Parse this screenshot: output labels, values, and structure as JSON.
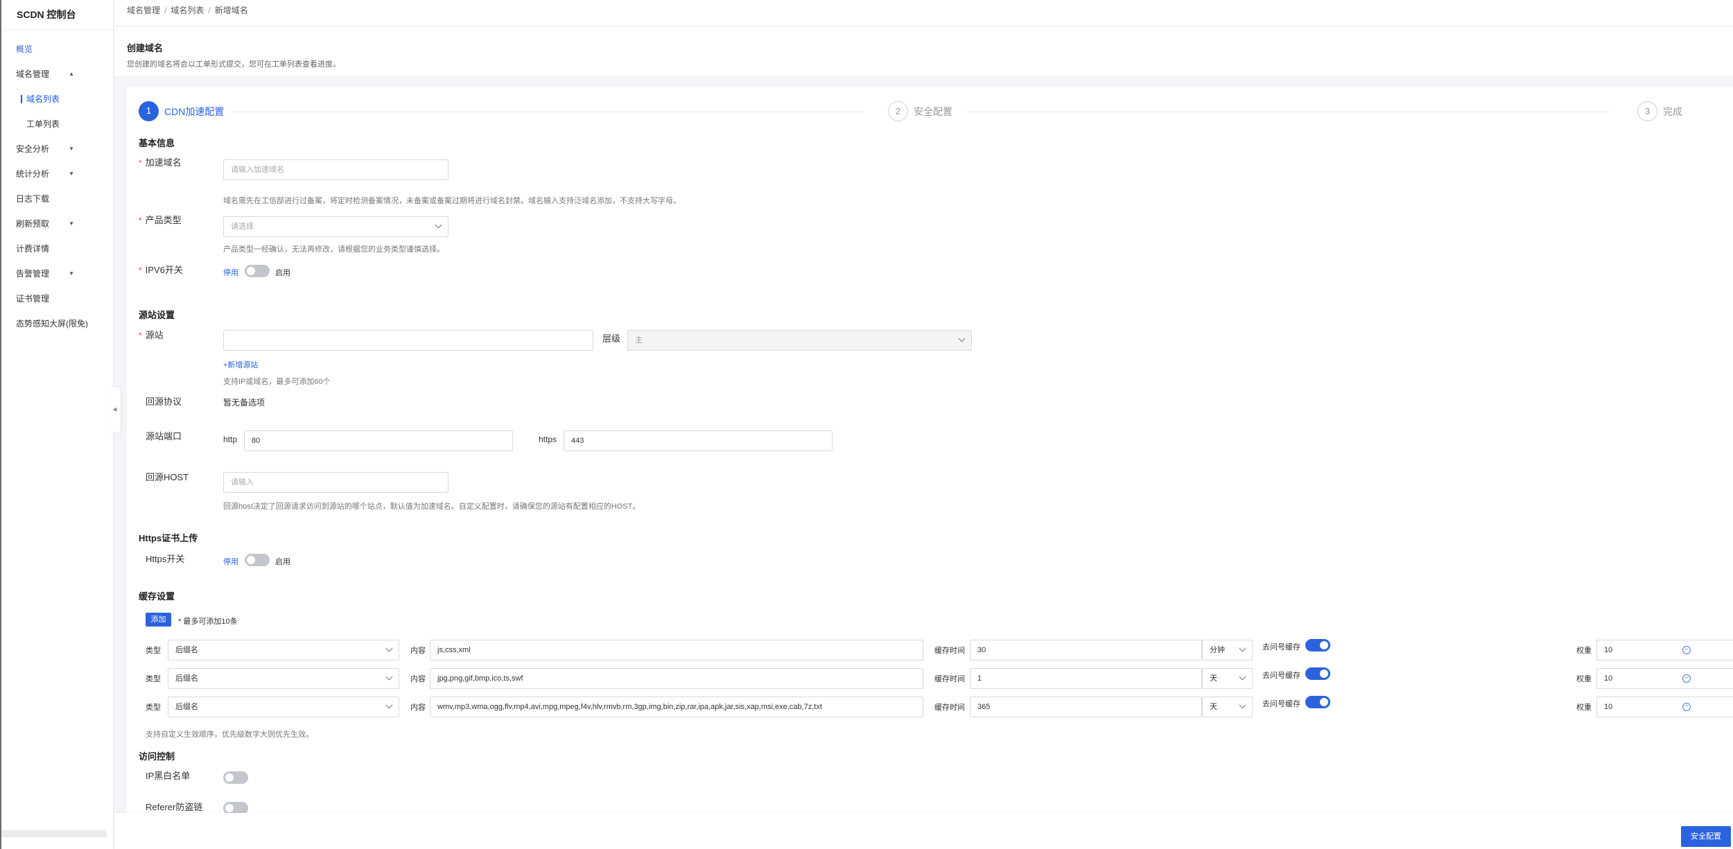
{
  "app": {
    "title": "SCDN 控制台"
  },
  "sidebar": {
    "items": [
      {
        "label": "概览"
      },
      {
        "label": "域名管理",
        "arrow": "▲"
      },
      {
        "label": "域名列表"
      },
      {
        "label": "工单列表"
      },
      {
        "label": "安全分析",
        "arrow": "▼"
      },
      {
        "label": "统计分析",
        "arrow": "▼"
      },
      {
        "label": "日志下载"
      },
      {
        "label": "刷新预取",
        "arrow": "▼"
      },
      {
        "label": "计费详情"
      },
      {
        "label": "告警管理",
        "arrow": "▼"
      },
      {
        "label": "证书管理"
      },
      {
        "label": "态势感知大屏(限免)"
      }
    ],
    "collapse_glyph": "◀"
  },
  "breadcrumb": {
    "items": [
      "域名管理",
      "域名列表",
      "新增域名"
    ],
    "separator": "/"
  },
  "page": {
    "title": "创建域名",
    "description": "您创建的域名将会以工单形式提交，您可在工单列表查看进度。"
  },
  "steps": [
    {
      "num": "1",
      "label": "CDN加速配置",
      "active": true
    },
    {
      "num": "2",
      "label": "安全配置",
      "active": false
    },
    {
      "num": "3",
      "label": "完成",
      "active": false
    }
  ],
  "basic": {
    "title": "基本信息",
    "required_mark": "*",
    "domain_label": "加速域名",
    "domain_placeholder": "请输入加速域名",
    "domain_hint": "域名需先在工信部进行过备案，将定时检测备案情况，未备案或备案过期将进行域名封禁。域名输入支持泛域名添加，不支持大写字母。",
    "product_label": "产品类型",
    "product_placeholder": "请选择",
    "product_hint": "产品类型一经确认，无法再修改，请根据您的业务类型谨慎选择。",
    "ipv6_label": "IPV6开关",
    "off_text": "停用",
    "on_text": "启用"
  },
  "origin": {
    "title": "源站设置",
    "origin_label": "源站",
    "origin_value": "",
    "level_label": "层级",
    "level_value": "主",
    "add_link": "+新增源站",
    "origin_hint": "支持IP或域名，最多可添加60个",
    "protocol_label": "回源协议",
    "protocol_value": "暂无备选项",
    "port_label": "源站端口",
    "http_label": "http",
    "http_value": "80",
    "https_label": "https",
    "https_value": "443",
    "host_label": "回源HOST",
    "host_placeholder": "请输入",
    "host_hint": "回源host决定了回源请求访问到源站的哪个站点，默认值为加速域名。自定义配置时，请确保您的源站有配置相应的HOST。"
  },
  "https": {
    "title": "Https证书上传",
    "switch_label": "Https开关"
  },
  "cache": {
    "title": "缓存设置",
    "add_button": "添加",
    "add_hint": "* 最多可添加10条",
    "type_label": "类型",
    "content_label": "内容",
    "time_label": "缓存时间",
    "qs_label": "去问号缓存",
    "weight_label": "权重",
    "remove_glyph": "−",
    "rows": [
      {
        "type": "后缀名",
        "content": "js,css,xml",
        "time": "30",
        "unit": "分钟",
        "weight": "10"
      },
      {
        "type": "后缀名",
        "content": "jpg,png,gif,bmp,ico,ts,swf",
        "time": "1",
        "unit": "天",
        "weight": "10"
      },
      {
        "type": "后缀名",
        "content": "wmv,mp3,wma,ogg,flv,mp4,avi,mpg,mpeg,f4v,hlv,rmvb,rm,3gp,img,bin,zip,rar,ipa,apk,jar,sis,xap,msi,exe,cab,7z,txt",
        "time": "365",
        "unit": "天",
        "weight": "10"
      }
    ],
    "footer_hint": "支持自定义生效顺序，优先级数字大则优先生效。"
  },
  "access": {
    "title": "访问控制",
    "ip_label": "IP黑白名单",
    "referer_label": "Referer防盗链"
  },
  "footer": {
    "next_button": "安全配置"
  }
}
